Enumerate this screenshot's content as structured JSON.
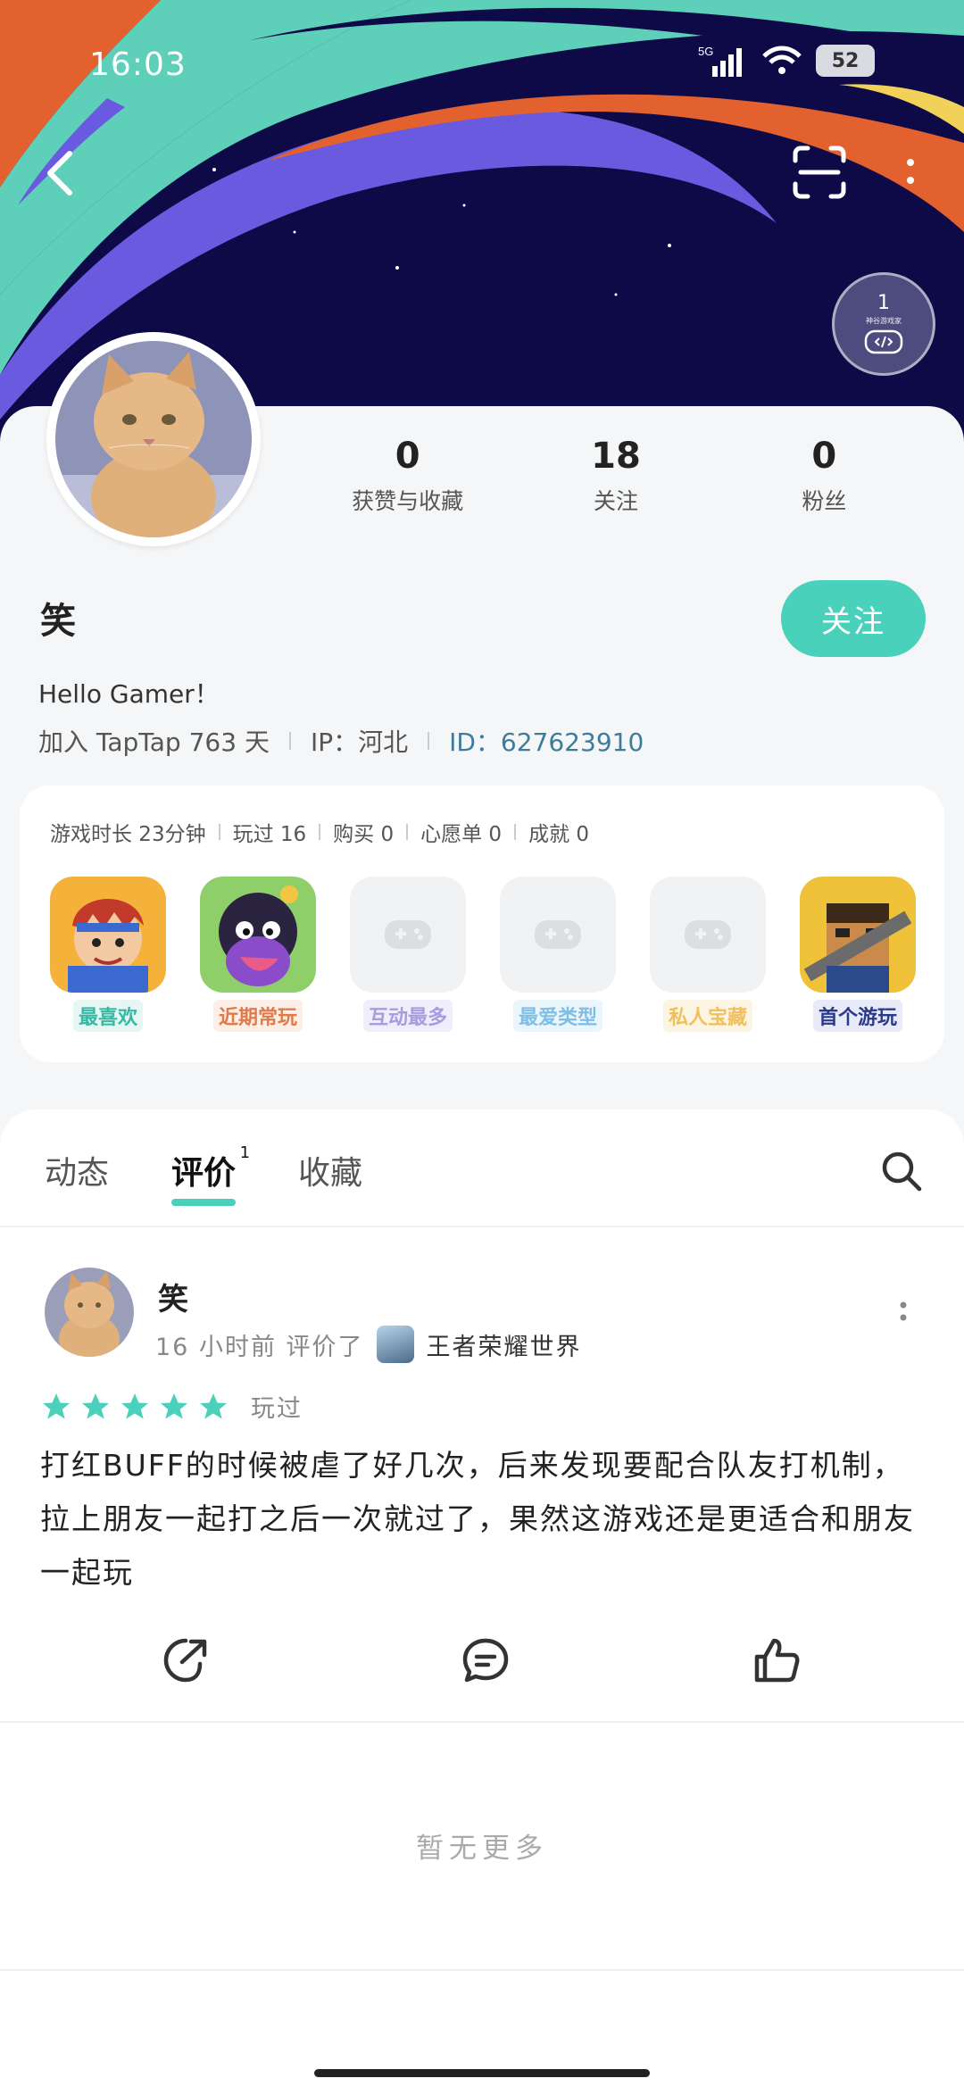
{
  "status_bar": {
    "time": "16:03",
    "network": "5G",
    "battery": "52"
  },
  "header": {
    "level_badge": {
      "level": "1",
      "label": "神谷游戏家"
    }
  },
  "profile": {
    "name": "笑",
    "follow_label": "关注",
    "bio": "Hello Gamer！",
    "joined": "加入 TapTap 763 天",
    "ip": "IP：河北",
    "id": "ID：627623910",
    "stats": [
      {
        "value": "0",
        "label": "获赞与收藏"
      },
      {
        "value": "18",
        "label": "关注"
      },
      {
        "value": "0",
        "label": "粉丝"
      }
    ]
  },
  "game_card": {
    "meta": [
      "游戏时长 23分钟",
      "玩过 16",
      "购买 0",
      "心愿单 0",
      "成就 0"
    ],
    "tiles": [
      {
        "label": "最喜欢",
        "color": "#36b8a4",
        "bg": "#e6f7f3",
        "has_game": true
      },
      {
        "label": "近期常玩",
        "color": "#e07a4a",
        "bg": "#fcefe7",
        "has_game": true
      },
      {
        "label": "互动最多",
        "color": "#a89be0",
        "bg": "#f1eefb",
        "has_game": false
      },
      {
        "label": "最爱类型",
        "color": "#7fbfe6",
        "bg": "#ebf5fc",
        "has_game": false
      },
      {
        "label": "私人宝藏",
        "color": "#f0c060",
        "bg": "#fdf5e3",
        "has_game": false
      },
      {
        "label": "首个游玩",
        "color": "#2b3a8a",
        "bg": "#e8ebf7",
        "has_game": true
      }
    ]
  },
  "tabs": [
    {
      "label": "动态"
    },
    {
      "label": "评价",
      "count": "1",
      "active": true
    },
    {
      "label": "收藏"
    }
  ],
  "review": {
    "author": "笑",
    "time": "16 小时前",
    "action": "评价了",
    "game": "王者荣耀世界",
    "rating": 5,
    "status": "玩过",
    "text": "打红BUFF的时候被虐了好几次，后来发现要配合队友打机制，拉上朋友一起打之后一次就过了，果然这游戏还是更适合和朋友一起玩"
  },
  "footer": {
    "no_more": "暂无更多"
  },
  "colors": {
    "accent": "#4ad1bb",
    "banner_bg": "#0d0a47",
    "id_blue": "#3e7d99"
  }
}
